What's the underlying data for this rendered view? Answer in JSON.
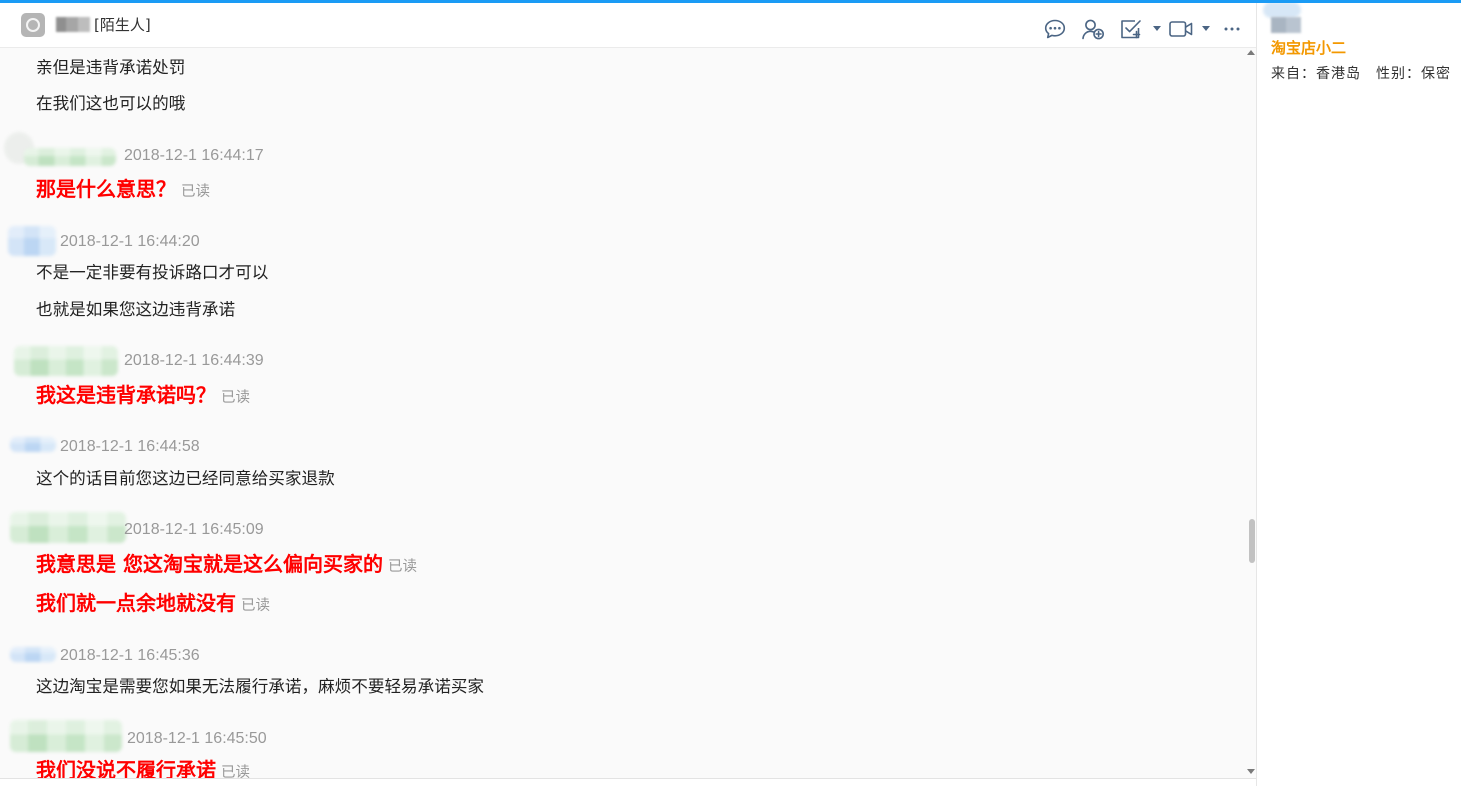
{
  "colors": {
    "accent": "#1a9bf5",
    "sent_text": "#ff0000",
    "received_text": "#222222",
    "meta_text": "#999999",
    "profile_name": "#f39800",
    "icon": "#4b6584"
  },
  "header": {
    "contact_tag": "[陌生人]",
    "icons": {
      "avatar": "default-avatar-icon",
      "chat": "chat-bubble-icon",
      "add_contact": "add-contact-icon",
      "todo": "todo-check-icon",
      "video": "video-call-icon",
      "dropdown": "chevron-down-icon",
      "more": "more-icon"
    }
  },
  "messages": [
    {
      "lines": [
        {
          "text": "亲但是违背承诺处罚"
        },
        {
          "text": "在我们这也可以的哦"
        }
      ]
    },
    {
      "time": "2018-12-1 16:44:17",
      "lines": [
        {
          "text": "那是什么意思？",
          "status": "已读"
        }
      ]
    },
    {
      "time": "2018-12-1 16:44:20",
      "lines": [
        {
          "text": "不是一定非要有投诉路口才可以"
        },
        {
          "text": "也就是如果您这边违背承诺"
        }
      ]
    },
    {
      "time": "2018-12-1 16:44:39",
      "lines": [
        {
          "text": "我这是违背承诺吗？",
          "status": "已读"
        }
      ]
    },
    {
      "time": "2018-12-1 16:44:58",
      "lines": [
        {
          "text": "这个的话目前您这边已经同意给买家退款"
        }
      ]
    },
    {
      "time": "2018-12-1 16:45:09",
      "lines": [
        {
          "text": "我意思是 您这淘宝就是这么偏向买家的",
          "status": "已读"
        },
        {
          "text": "我们就一点余地就没有",
          "status": "已读"
        }
      ]
    },
    {
      "time": "2018-12-1 16:45:36",
      "lines": [
        {
          "text": "这边淘宝是需要您如果无法履行承诺，麻烦不要轻易承诺买家"
        }
      ]
    },
    {
      "time": "2018-12-1 16:45:50",
      "lines": [
        {
          "text": "我们没说不履行承诺",
          "status": "已读"
        }
      ]
    }
  ],
  "profile": {
    "name": "淘宝店小二",
    "location": "来自：香港岛",
    "gender": "性别：保密"
  }
}
